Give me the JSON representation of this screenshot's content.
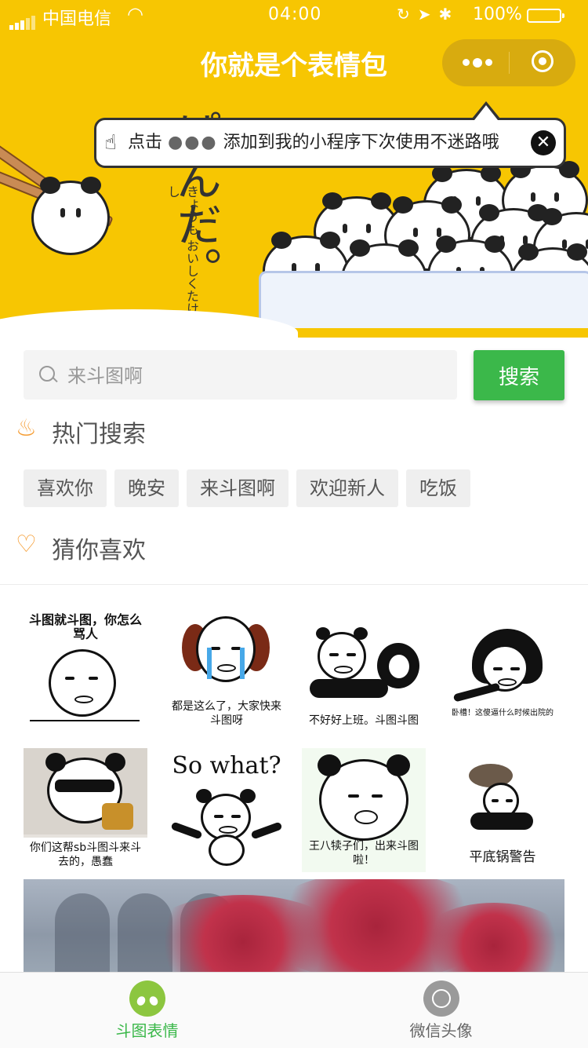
{
  "status_bar": {
    "carrier": "中国电信",
    "time": "04:00",
    "battery": "100%",
    "battery_level": 1.0
  },
  "nav": {
    "title": "你就是个表情包"
  },
  "tooltip": {
    "prefix": "点击",
    "dots": "●●●",
    "suffix": "添加到我的小程序下次使用不迷路哦",
    "close": "✕"
  },
  "banner": {
    "jp_text": "ぱんだ。",
    "jp_small": "きょうも おいしくたけまし"
  },
  "search": {
    "placeholder": "来斗图啊",
    "value": "",
    "button": "搜索"
  },
  "hot": {
    "title": "热门搜索",
    "tags": [
      "喜欢你",
      "晚安",
      "来斗图啊",
      "欢迎新人",
      "吃饭"
    ]
  },
  "guess": {
    "title": "猜你喜欢"
  },
  "memes": [
    {
      "caption": "斗图就斗图，你怎么骂人"
    },
    {
      "caption": "都是这么了，大家快来斗图呀"
    },
    {
      "caption": "不好好上班。斗图斗图"
    },
    {
      "caption": "卧槽！这傻逼什么时候出院的"
    },
    {
      "caption": "你们这帮sb斗图斗来斗去的，愚蠢"
    },
    {
      "caption": "So what?"
    },
    {
      "caption": "王八犊子们，出来斗图啦！"
    },
    {
      "caption": "平底锅警告"
    }
  ],
  "tabbar": {
    "tabs": [
      {
        "label": "斗图表情",
        "active": true
      },
      {
        "label": "微信头像",
        "active": false
      }
    ]
  },
  "colors": {
    "banner": "#f7c602",
    "accent": "#3bb84a",
    "hot_icon": "#f59d34"
  }
}
